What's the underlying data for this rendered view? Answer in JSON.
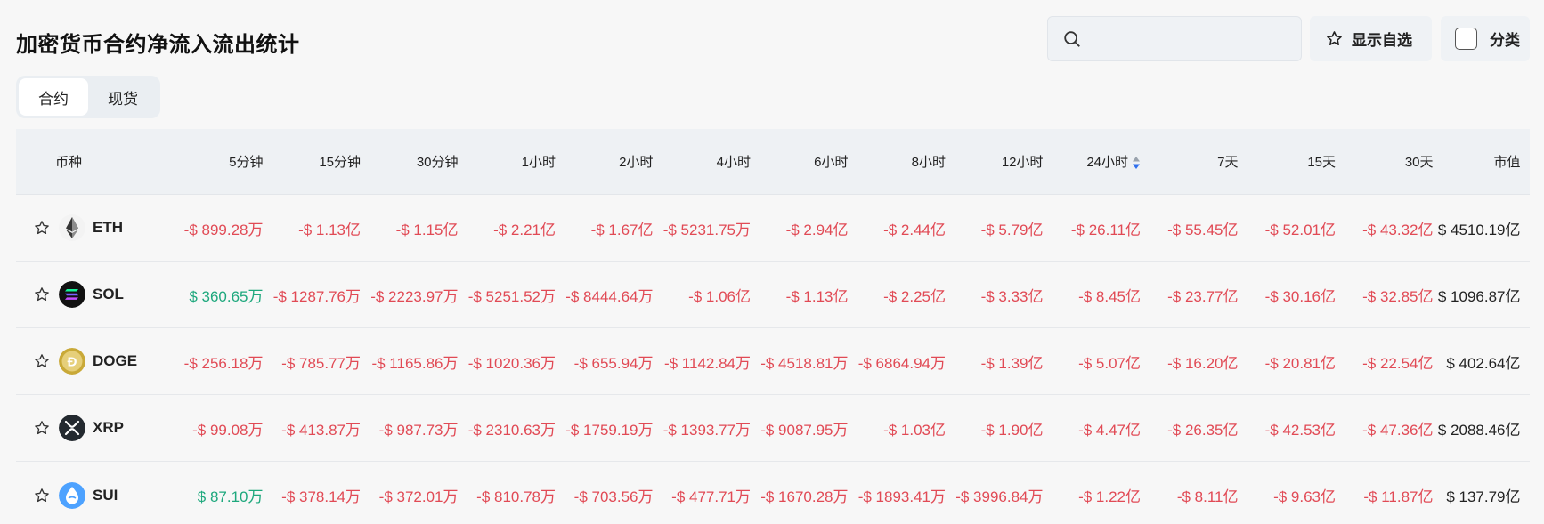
{
  "page": {
    "title": "加密货币合约净流入流出统计"
  },
  "search": {
    "placeholder": ""
  },
  "toolbar": {
    "favorites_label": "显示自选",
    "category_label": "分类"
  },
  "tabs": [
    {
      "label": "合约",
      "active": true
    },
    {
      "label": "现货",
      "active": false
    }
  ],
  "colors": {
    "negative": "#e14a55",
    "positive": "#1ea87d",
    "sort_active": "#2f6fed"
  },
  "table": {
    "columns": [
      "币种",
      "5分钟",
      "15分钟",
      "30分钟",
      "1小时",
      "2小时",
      "4小时",
      "6小时",
      "8小时",
      "12小时",
      "24小时",
      "7天",
      "15天",
      "30天",
      "市值"
    ],
    "sorted_column": "24小时",
    "rows": [
      {
        "symbol": "ETH",
        "icon": "eth-icon",
        "values": [
          {
            "text": "-$ 899.28万",
            "sign": "neg"
          },
          {
            "text": "-$ 1.13亿",
            "sign": "neg"
          },
          {
            "text": "-$ 1.15亿",
            "sign": "neg"
          },
          {
            "text": "-$ 2.21亿",
            "sign": "neg"
          },
          {
            "text": "-$ 1.67亿",
            "sign": "neg"
          },
          {
            "text": "-$ 5231.75万",
            "sign": "neg"
          },
          {
            "text": "-$ 2.94亿",
            "sign": "neg"
          },
          {
            "text": "-$ 2.44亿",
            "sign": "neg"
          },
          {
            "text": "-$ 5.79亿",
            "sign": "neg"
          },
          {
            "text": "-$ 26.11亿",
            "sign": "neg"
          },
          {
            "text": "-$ 55.45亿",
            "sign": "neg"
          },
          {
            "text": "-$ 52.01亿",
            "sign": "neg"
          },
          {
            "text": "-$ 43.32亿",
            "sign": "neg"
          }
        ],
        "market_cap": "$ 4510.19亿"
      },
      {
        "symbol": "SOL",
        "icon": "sol-icon",
        "values": [
          {
            "text": "$ 360.65万",
            "sign": "pos"
          },
          {
            "text": "-$ 1287.76万",
            "sign": "neg"
          },
          {
            "text": "-$ 2223.97万",
            "sign": "neg"
          },
          {
            "text": "-$ 5251.52万",
            "sign": "neg"
          },
          {
            "text": "-$ 8444.64万",
            "sign": "neg"
          },
          {
            "text": "-$ 1.06亿",
            "sign": "neg"
          },
          {
            "text": "-$ 1.13亿",
            "sign": "neg"
          },
          {
            "text": "-$ 2.25亿",
            "sign": "neg"
          },
          {
            "text": "-$ 3.33亿",
            "sign": "neg"
          },
          {
            "text": "-$ 8.45亿",
            "sign": "neg"
          },
          {
            "text": "-$ 23.77亿",
            "sign": "neg"
          },
          {
            "text": "-$ 30.16亿",
            "sign": "neg"
          },
          {
            "text": "-$ 32.85亿",
            "sign": "neg"
          }
        ],
        "market_cap": "$ 1096.87亿"
      },
      {
        "symbol": "DOGE",
        "icon": "doge-icon",
        "values": [
          {
            "text": "-$ 256.18万",
            "sign": "neg"
          },
          {
            "text": "-$ 785.77万",
            "sign": "neg"
          },
          {
            "text": "-$ 1165.86万",
            "sign": "neg"
          },
          {
            "text": "-$ 1020.36万",
            "sign": "neg"
          },
          {
            "text": "-$ 655.94万",
            "sign": "neg"
          },
          {
            "text": "-$ 1142.84万",
            "sign": "neg"
          },
          {
            "text": "-$ 4518.81万",
            "sign": "neg"
          },
          {
            "text": "-$ 6864.94万",
            "sign": "neg"
          },
          {
            "text": "-$ 1.39亿",
            "sign": "neg"
          },
          {
            "text": "-$ 5.07亿",
            "sign": "neg"
          },
          {
            "text": "-$ 16.20亿",
            "sign": "neg"
          },
          {
            "text": "-$ 20.81亿",
            "sign": "neg"
          },
          {
            "text": "-$ 22.54亿",
            "sign": "neg"
          }
        ],
        "market_cap": "$ 402.64亿"
      },
      {
        "symbol": "XRP",
        "icon": "xrp-icon",
        "values": [
          {
            "text": "-$ 99.08万",
            "sign": "neg"
          },
          {
            "text": "-$ 413.87万",
            "sign": "neg"
          },
          {
            "text": "-$ 987.73万",
            "sign": "neg"
          },
          {
            "text": "-$ 2310.63万",
            "sign": "neg"
          },
          {
            "text": "-$ 1759.19万",
            "sign": "neg"
          },
          {
            "text": "-$ 1393.77万",
            "sign": "neg"
          },
          {
            "text": "-$ 9087.95万",
            "sign": "neg"
          },
          {
            "text": "-$ 1.03亿",
            "sign": "neg"
          },
          {
            "text": "-$ 1.90亿",
            "sign": "neg"
          },
          {
            "text": "-$ 4.47亿",
            "sign": "neg"
          },
          {
            "text": "-$ 26.35亿",
            "sign": "neg"
          },
          {
            "text": "-$ 42.53亿",
            "sign": "neg"
          },
          {
            "text": "-$ 47.36亿",
            "sign": "neg"
          }
        ],
        "market_cap": "$ 2088.46亿"
      },
      {
        "symbol": "SUI",
        "icon": "sui-icon",
        "values": [
          {
            "text": "$ 87.10万",
            "sign": "pos"
          },
          {
            "text": "-$ 378.14万",
            "sign": "neg"
          },
          {
            "text": "-$ 372.01万",
            "sign": "neg"
          },
          {
            "text": "-$ 810.78万",
            "sign": "neg"
          },
          {
            "text": "-$ 703.56万",
            "sign": "neg"
          },
          {
            "text": "-$ 477.71万",
            "sign": "neg"
          },
          {
            "text": "-$ 1670.28万",
            "sign": "neg"
          },
          {
            "text": "-$ 1893.41万",
            "sign": "neg"
          },
          {
            "text": "-$ 3996.84万",
            "sign": "neg"
          },
          {
            "text": "-$ 1.22亿",
            "sign": "neg"
          },
          {
            "text": "-$ 8.11亿",
            "sign": "neg"
          },
          {
            "text": "-$ 9.63亿",
            "sign": "neg"
          },
          {
            "text": "-$ 11.87亿",
            "sign": "neg"
          }
        ],
        "market_cap": "$ 137.79亿"
      }
    ]
  }
}
